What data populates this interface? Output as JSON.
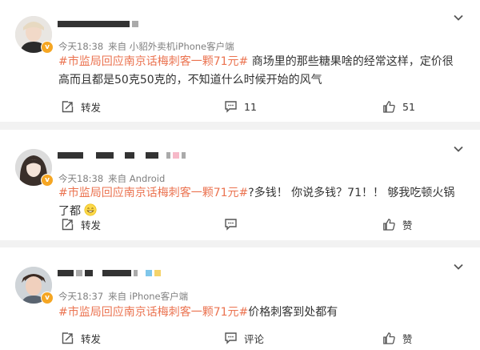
{
  "posts": [
    {
      "time": "今天18:38",
      "source": "来自 小貂外卖机iPhone客户端",
      "topic": "#市监局回应南京话梅刺客一颗71元#",
      "text": " 商场里的那些糖果啥的经常这样，定价很高而且都是50克50克的，不知道什么时候开始的风气",
      "repost_label": "转发",
      "comment_label": "11",
      "like_label": "51"
    },
    {
      "time": "今天18:38",
      "source": "来自 Android",
      "topic": "#市监局回应南京话梅刺客一颗71元#",
      "text": "?多钱！ 你说多钱？71！！ 够我吃顿火锅了都",
      "repost_label": "转发",
      "comment_label": "",
      "like_label": "赞"
    },
    {
      "time": "今天18:37",
      "source": "来自 iPhone客户端",
      "topic": "#市监局回应南京话梅刺客一颗71元#",
      "text": "价格刺客到处都有",
      "repost_label": "转发",
      "comment_label": "评论",
      "like_label": "赞"
    }
  ],
  "icons": {
    "verified": "verified-badge",
    "menu": "chevron-down-icon",
    "repost": "repost-icon",
    "comment": "comment-icon",
    "like": "like-icon",
    "emoji": "grin-emoji"
  },
  "colors": {
    "topic": "#eb7350",
    "badge": "#f5a623",
    "meta": "#808080"
  }
}
